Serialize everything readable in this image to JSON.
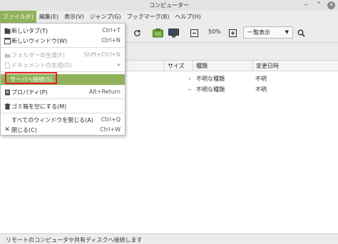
{
  "window": {
    "title": "コンピューター",
    "controls": {
      "minimize": "–",
      "maximize": "⌃",
      "close": "✕"
    }
  },
  "menubar": {
    "items": [
      {
        "label": "ファイル(F)",
        "active": true
      },
      {
        "label": "編集(E)"
      },
      {
        "label": "表示(V)"
      },
      {
        "label": "ジャンプ(G)"
      },
      {
        "label": "ブックマーク(B)"
      },
      {
        "label": "ヘルプ(H)"
      }
    ]
  },
  "toolbar": {
    "icons": [
      "reload-icon",
      "computer-icon",
      "monitor-icon",
      "zoom-out-icon",
      "zoom-in-icon",
      "search-icon"
    ],
    "zoom": "50%",
    "view_mode": "一覧表示"
  },
  "columns": {
    "size": "サイズ",
    "type": "種類",
    "modified": "変更日時"
  },
  "rows": [
    {
      "size": "–",
      "type": "不明な種類",
      "modified": "不明"
    },
    {
      "size": "–",
      "type": "不明な種類",
      "modified": "不明"
    }
  ],
  "file_menu": {
    "items": [
      {
        "label": "新しいタブ(T)",
        "shortcut": "Ctrl+T",
        "icon": "new-tab-icon"
      },
      {
        "label": "新しいウィンドウ(W)",
        "shortcut": "Ctrl+N",
        "icon": "new-window-icon"
      },
      {
        "label": "フォルダーの生成(F)",
        "shortcut": "Shift+Ctrl+N",
        "icon": "new-folder-icon",
        "disabled": true
      },
      {
        "label": "ドキュメントの生成(D)",
        "shortcut": "▸",
        "icon": "new-document-icon",
        "disabled": true
      },
      {
        "label": "サーバへ接続(S)...",
        "shortcut": "",
        "icon": "",
        "highlighted": true
      },
      {
        "label": "プロパティ(P)",
        "shortcut": "Alt+Return",
        "icon": "properties-icon"
      },
      {
        "label": "ゴミ箱を空にする(M)",
        "shortcut": "",
        "icon": "trash-icon"
      },
      {
        "label": "すべてのウィンドウを閉じる(A)",
        "shortcut": "Ctrl+Q",
        "icon": ""
      },
      {
        "label": "閉じる(C)",
        "shortcut": "Ctrl+W",
        "icon": "close-icon"
      }
    ]
  },
  "statusbar": {
    "text": "リモートのコンピュータや共有ディスクへ接続します"
  },
  "colors": {
    "accent": "#8fb25a",
    "highlight_box": "#e02020"
  }
}
